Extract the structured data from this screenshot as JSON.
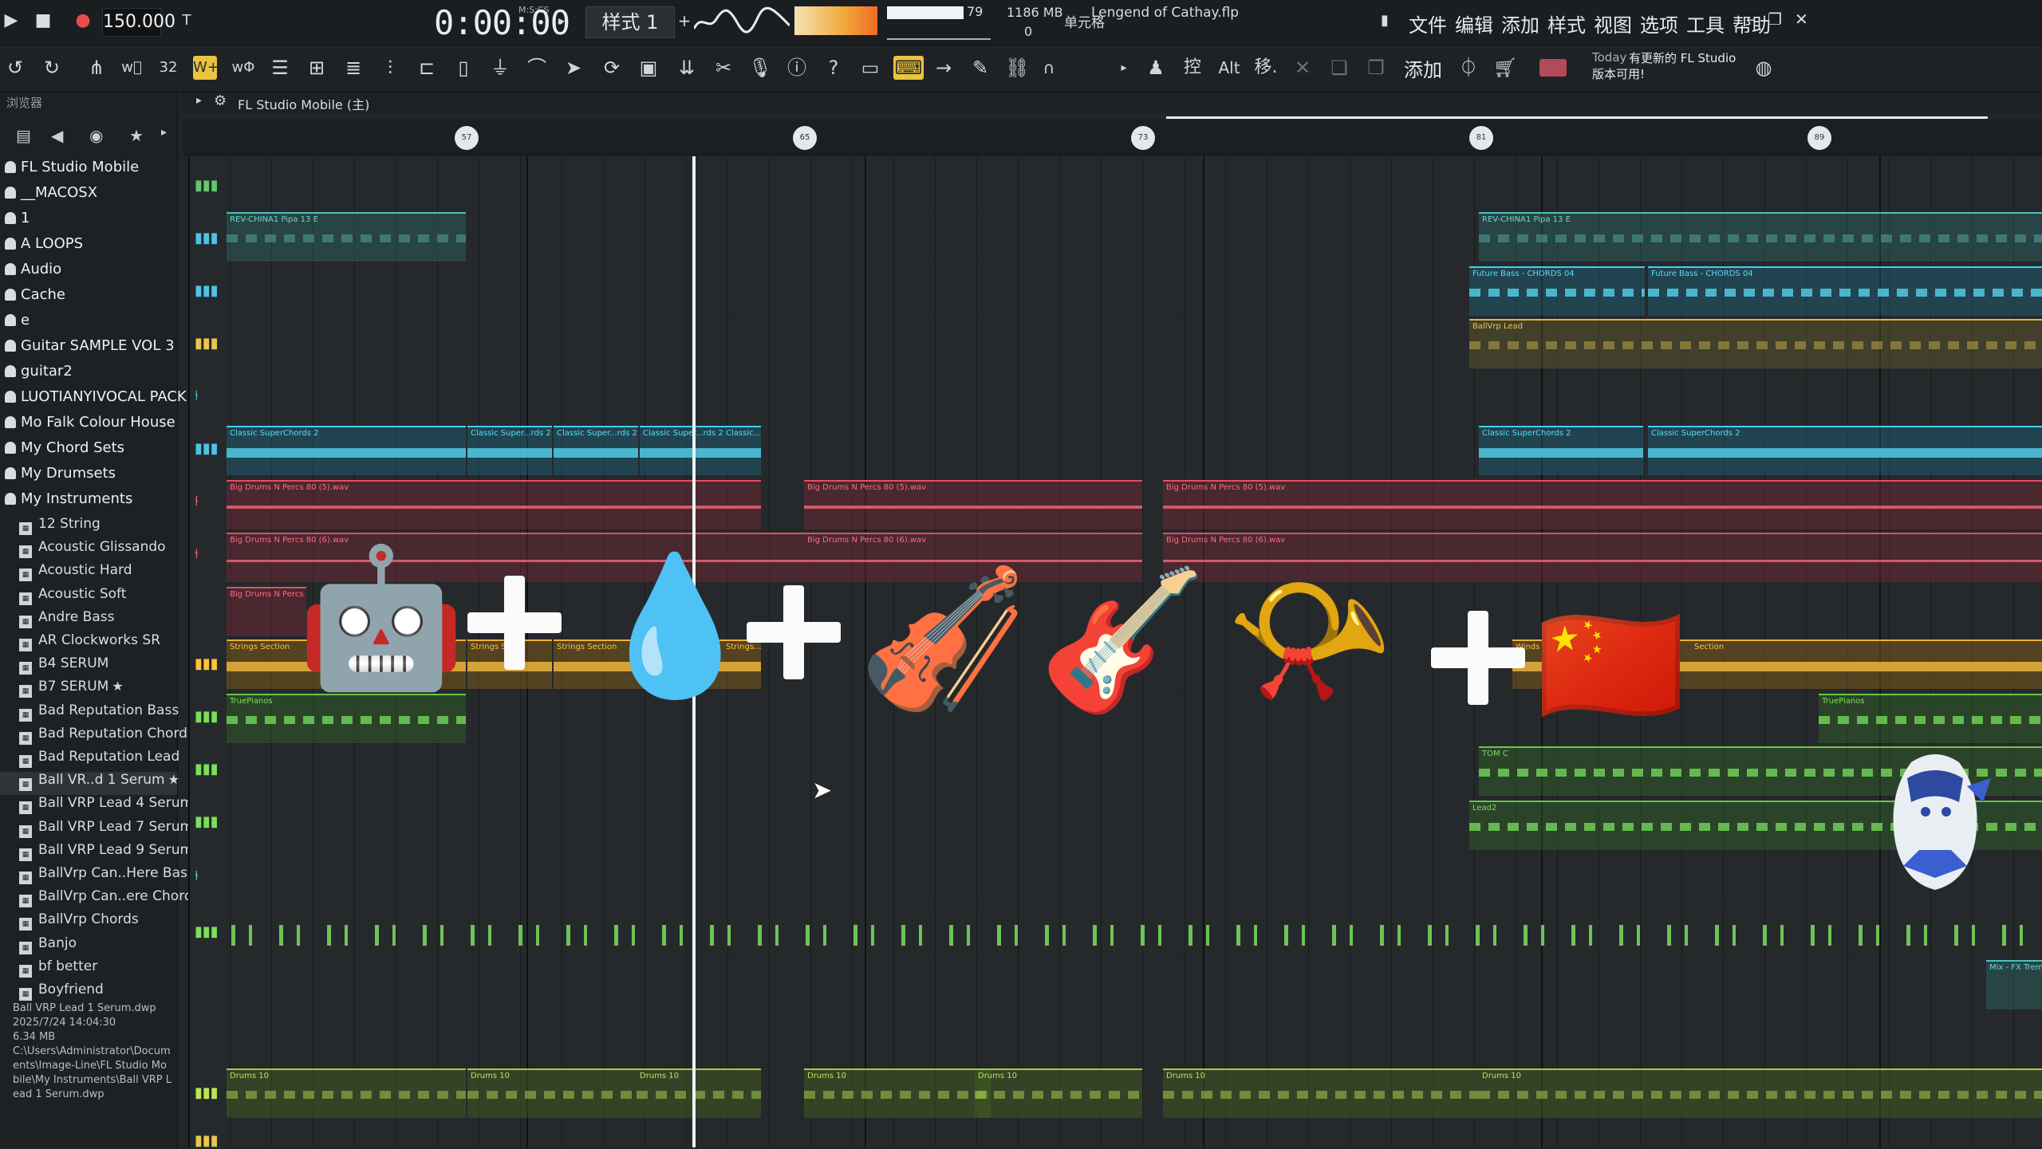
{
  "transport": {
    "tempo": "150.000",
    "time_format_label": "M:S:CS",
    "time": "0:00:00",
    "pattern": "样式 1",
    "cpu": "79",
    "memory": "1186 MB",
    "voices": "0",
    "project_title": "Lengend of Cathay.flp"
  },
  "menu": [
    "文件",
    "编辑",
    "添加",
    "样式",
    "视图",
    "选项",
    "工具",
    "帮助"
  ],
  "toolbar": {
    "snap_label": "单元格",
    "add_label": "添加",
    "alt_label": "Alt",
    "control_label": "控",
    "move_label": "移."
  },
  "news": {
    "date": "Today",
    "text_line1": "有更新的 FL Studio",
    "text_line2": "版本可用!"
  },
  "browser": {
    "title": "浏览器",
    "folders": [
      "FL Studio Mobile",
      "__MACOSX",
      "1",
      "A LOOPS",
      "Audio",
      "Cache",
      "e",
      "Guitar SAMPLE VOL 3",
      "guitar2",
      "LUOTIANYIVOCAL PACK",
      "Mo Falk Colour House",
      "My Chord Sets",
      "My Drumsets",
      "My Instruments"
    ],
    "files": [
      "12 String",
      "Acoustic Glissando",
      "Acoustic Hard",
      "Acoustic Soft",
      "Andre Bass",
      "AR Clockworks SR",
      "B4 SERUM",
      "B7 SERUM",
      "Bad Reputation Bass",
      "Bad Reputation Chords",
      "Bad Reputation Lead",
      "Ball VR..d 1 Serum",
      "Ball VRP Lead 4 Serum",
      "Ball VRP Lead 7 Serum",
      "Ball VRP Lead 9 Serum",
      "BallVrp Can..Here Bass",
      "BallVrp Can..ere Chords",
      "BallVrp Chords",
      "Banjo",
      "bf better",
      "Boyfriend"
    ],
    "file_info": {
      "name": "Ball VRP Lead 1 Serum.dwp",
      "date": "2025/7/24 14:04:30",
      "size": "6.34 MB",
      "path": "C:\\Users\\Administrator\\Documents\\Image-Line\\FL Studio Mobile\\My Instruments\\Ball VRP Lead 1 Serum.dwp"
    }
  },
  "playlist": {
    "title": "FL Studio Mobile (主)",
    "bar_markers": [
      "57",
      "65",
      "73",
      "81",
      "89"
    ],
    "clips": [
      {
        "label": "REV-CHINA1 Pipa 13 E",
        "color": "teal"
      },
      {
        "label": "REV-CHINA1 Pipa 13 E",
        "color": "teal"
      },
      {
        "label": "Future Bass - CHORDS 04",
        "color": "cyan"
      },
      {
        "label": "Future Bass - CHORDS 04",
        "color": "cyan"
      },
      {
        "label": "BallVrp Lead",
        "color": "yellow"
      },
      {
        "label": "Classic SuperChords 2",
        "color": "cyan"
      },
      {
        "label": "Classic Super...rds 2",
        "color": "cyan"
      },
      {
        "label": "Classic Super...rds 2",
        "color": "cyan"
      },
      {
        "label": "Classic Super...rds 2",
        "color": "cyan"
      },
      {
        "label": "Classic...",
        "color": "cyan"
      },
      {
        "label": "Classic SuperChords 2",
        "color": "cyan"
      },
      {
        "label": "Classic SuperChords 2",
        "color": "cyan"
      },
      {
        "label": "Big Drums N Percs 80 (5).wav",
        "color": "red"
      },
      {
        "label": "Big Drums N Percs 80 (5).wav",
        "color": "red"
      },
      {
        "label": "Big Drums N Percs 80 (5).wav",
        "color": "red"
      },
      {
        "label": "Big Drums N Percs 80 (6).wav",
        "color": "red"
      },
      {
        "label": "Big Drums N Percs 80 (6).wav",
        "color": "red"
      },
      {
        "label": "Big Drums N Percs 80 (6).wav",
        "color": "red"
      },
      {
        "label": "Big Drums N Percs",
        "color": "red"
      },
      {
        "label": "Strings Section",
        "color": "orange"
      },
      {
        "label": "Strings S...",
        "color": "orange"
      },
      {
        "label": "Strings Section",
        "color": "orange"
      },
      {
        "label": "Strings...",
        "color": "orange"
      },
      {
        "label": "Winds Section",
        "color": "orange"
      },
      {
        "label": "Section",
        "color": "orange"
      },
      {
        "label": "TruePianos",
        "color": "green"
      },
      {
        "label": "TruePianos",
        "color": "green"
      },
      {
        "label": "TOM C",
        "color": "green"
      },
      {
        "label": "Lead2",
        "color": "green"
      },
      {
        "label": "Mix - FX Trem",
        "color": "teal"
      },
      {
        "label": "Drums 10",
        "color": "lime"
      },
      {
        "label": "Drums 10",
        "color": "lime"
      },
      {
        "label": "Drums 10",
        "color": "lime"
      },
      {
        "label": "Drums 10",
        "color": "lime"
      },
      {
        "label": "Drums 10",
        "color": "lime"
      },
      {
        "label": "Drums 10",
        "color": "lime"
      },
      {
        "label": "Drums 10",
        "color": "lime"
      }
    ]
  },
  "overlay": {
    "emojis": [
      "🤖",
      "💧",
      "🎻",
      "🎸",
      "📯",
      "🇨🇳"
    ],
    "plus_count": 3
  }
}
